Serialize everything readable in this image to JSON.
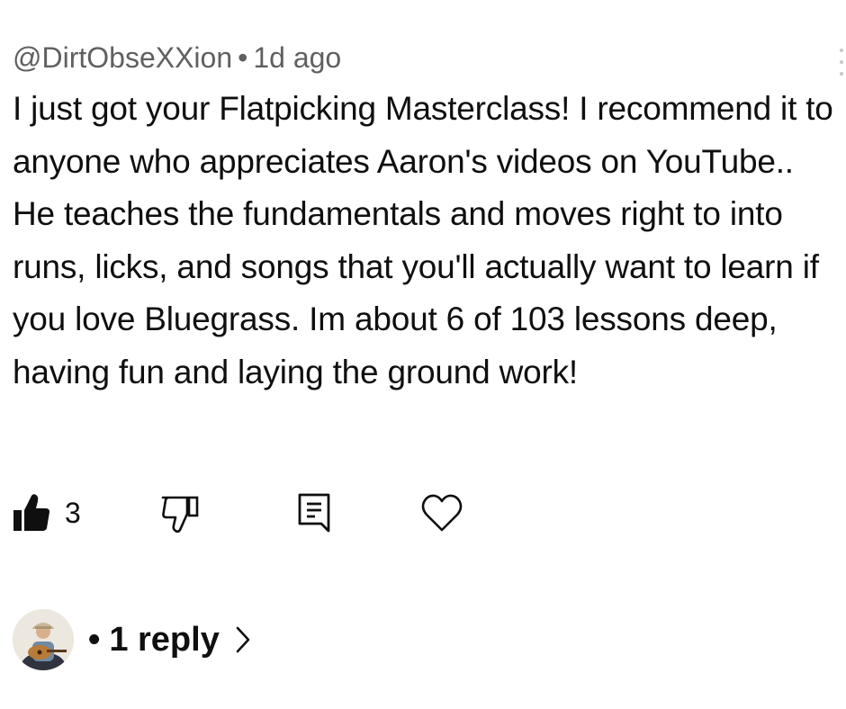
{
  "comment": {
    "author": "@DirtObseXXion",
    "separator": "•",
    "time": "1d ago",
    "text": "I just got your Flatpicking Masterclass! I recommend it to anyone who appreciates Aaron's videos on YouTube.. He teaches the fundamentals and moves right to into runs, licks, and songs that you'll actually want to learn if you love Bluegrass. Im about 6 of 103 lessons deep, having fun and laying the ground work!"
  },
  "actions": {
    "like_count": "3",
    "icons": [
      "thumbs-up-icon",
      "thumbs-down-icon",
      "reply-comment-icon",
      "heart-icon"
    ]
  },
  "replies": {
    "bullet": "•",
    "label": "1 reply",
    "avatar_icon": "creator-avatar"
  },
  "colors": {
    "text": "#0f0f0f",
    "meta": "#606060"
  }
}
